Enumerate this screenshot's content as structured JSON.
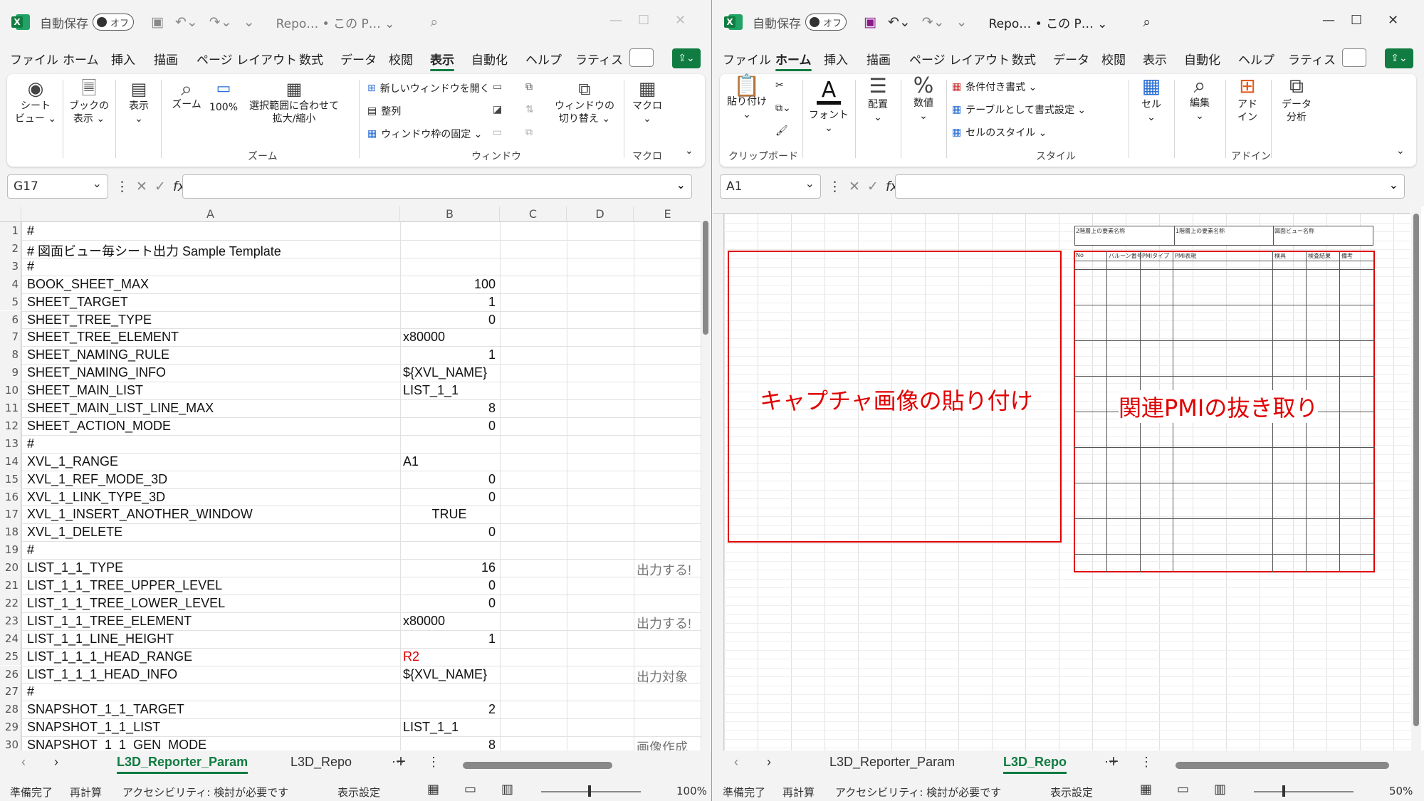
{
  "left": {
    "autosave_label": "自動保存",
    "autosave_state": "オフ",
    "doc_title": "Repo… • この P… ⌄",
    "menu": [
      "ファイル",
      "ホーム",
      "挿入",
      "描画",
      "ページ レイアウト",
      "数式",
      "データ",
      "校閲",
      "表示",
      "自動化",
      "ヘルプ",
      "ラティス"
    ],
    "active_menu": "表示",
    "ribbon": {
      "sheet_view": "シート\nビュー ⌄",
      "book_view": "ブックの\n表示 ⌄",
      "show": "表示\n⌄",
      "zoom": "ズーム",
      "zoom100": "100%",
      "zoom_fit": "選択範囲に合わせて\n拡大/縮小",
      "zoom_group": "ズーム",
      "new_window": "新しいウィンドウを開く",
      "arrange": "整列",
      "freeze": "ウィンドウ枠の固定 ⌄",
      "switch_window": "ウィンドウの\n切り替え ⌄",
      "window_group": "ウィンドウ",
      "macro": "マクロ\n⌄",
      "macro_group": "マクロ"
    },
    "namebox": "G17",
    "fx": "fx",
    "columns": [
      "A",
      "B",
      "C",
      "D",
      "E"
    ],
    "rows": [
      {
        "n": "1",
        "a": "#",
        "b": "",
        "e": ""
      },
      {
        "n": "2",
        "a": "#  図面ビュー毎シート出力 Sample Template",
        "b": "",
        "e": ""
      },
      {
        "n": "3",
        "a": "#",
        "b": "",
        "e": ""
      },
      {
        "n": "4",
        "a": "BOOK_SHEET_MAX",
        "b": "100",
        "e": ""
      },
      {
        "n": "5",
        "a": "SHEET_TARGET",
        "b": "1",
        "e": ""
      },
      {
        "n": "6",
        "a": "SHEET_TREE_TYPE",
        "b": "0",
        "e": ""
      },
      {
        "n": "7",
        "a": "SHEET_TREE_ELEMENT",
        "b": "x80000",
        "e": ""
      },
      {
        "n": "8",
        "a": "SHEET_NAMING_RULE",
        "b": "1",
        "e": ""
      },
      {
        "n": "9",
        "a": "SHEET_NAMING_INFO",
        "b": "${XVL_NAME}",
        "e": ""
      },
      {
        "n": "10",
        "a": "SHEET_MAIN_LIST",
        "b": "LIST_1_1",
        "e": ""
      },
      {
        "n": "11",
        "a": "SHEET_MAIN_LIST_LINE_MAX",
        "b": "8",
        "e": ""
      },
      {
        "n": "12",
        "a": "SHEET_ACTION_MODE",
        "b": "0",
        "e": ""
      },
      {
        "n": "13",
        "a": "#",
        "b": "",
        "e": ""
      },
      {
        "n": "14",
        "a": "XVL_1_RANGE",
        "b": "A1",
        "e": ""
      },
      {
        "n": "15",
        "a": "XVL_1_REF_MODE_3D",
        "b": "0",
        "e": ""
      },
      {
        "n": "16",
        "a": "XVL_1_LINK_TYPE_3D",
        "b": "0",
        "e": ""
      },
      {
        "n": "17",
        "a": "XVL_1_INSERT_ANOTHER_WINDOW",
        "b": "TRUE",
        "e": ""
      },
      {
        "n": "18",
        "a": "XVL_1_DELETE",
        "b": "0",
        "e": ""
      },
      {
        "n": "19",
        "a": "#",
        "b": "",
        "e": ""
      },
      {
        "n": "20",
        "a": "LIST_1_1_TYPE",
        "b": "16",
        "e": "出力する!"
      },
      {
        "n": "21",
        "a": "LIST_1_1_TREE_UPPER_LEVEL",
        "b": "0",
        "e": ""
      },
      {
        "n": "22",
        "a": "LIST_1_1_TREE_LOWER_LEVEL",
        "b": "0",
        "e": ""
      },
      {
        "n": "23",
        "a": "LIST_1_1_TREE_ELEMENT",
        "b": "x80000",
        "e": "出力する!"
      },
      {
        "n": "24",
        "a": "LIST_1_1_LINE_HEIGHT",
        "b": "1",
        "e": ""
      },
      {
        "n": "25",
        "a": "LIST_1_1_1_HEAD_RANGE",
        "b": "R2",
        "e": ""
      },
      {
        "n": "26",
        "a": "LIST_1_1_1_HEAD_INFO",
        "b": "${XVL_NAME}",
        "e": "出力対象"
      },
      {
        "n": "27",
        "a": "#",
        "b": "",
        "e": ""
      },
      {
        "n": "28",
        "a": "SNAPSHOT_1_1_TARGET",
        "b": "2",
        "e": ""
      },
      {
        "n": "29",
        "a": "SNAPSHOT_1_1_LIST",
        "b": "LIST_1_1",
        "e": ""
      },
      {
        "n": "30",
        "a": "SNAPSHOT_1_1_GEN_MODE",
        "b": "8",
        "e": "画像作成"
      }
    ],
    "red_value_color": "#e00000",
    "tabs": [
      "L3D_Reporter_Param",
      "L3D_Repo"
    ],
    "active_tab": "L3D_Reporter_Param",
    "status": {
      "ready": "準備完了",
      "recalc": "再計算",
      "accessibility": "アクセシビリティ: 検討が必要です",
      "display": "表示設定",
      "zoom": "100%"
    }
  },
  "right": {
    "autosave_label": "自動保存",
    "autosave_state": "オフ",
    "doc_title": "Repo… • この P… ⌄",
    "menu": [
      "ファイル",
      "ホーム",
      "挿入",
      "描画",
      "ページ レイアウト",
      "数式",
      "データ",
      "校閲",
      "表示",
      "自動化",
      "ヘルプ",
      "ラティス"
    ],
    "active_menu": "ホーム",
    "ribbon": {
      "paste": "貼り付け\n⌄",
      "clipboard_group": "クリップボード",
      "font": "フォント\n⌄",
      "align": "配置\n⌄",
      "number": "数値\n⌄",
      "cond_format": "条件付き書式 ⌄",
      "table_format": "テーブルとして書式設定 ⌄",
      "cell_style": "セルのスタイル ⌄",
      "style_group": "スタイル",
      "cell": "セル\n⌄",
      "edit": "編集\n⌄",
      "addin": "アド\nイン",
      "addin_group": "アドイン",
      "data_analysis": "データ\n分析"
    },
    "namebox": "A1",
    "fx": "fx",
    "header_labels": [
      "2階層上の要素名称",
      "1階層上の要素名称",
      "図面ビュー名称"
    ],
    "table_headers": [
      "No",
      "バルーン番号",
      "PMIタイプ",
      "PMI表現",
      "検具",
      "検査結果",
      "備考"
    ],
    "capture_label": "キャプチャ画像の貼り付け",
    "pmi_label": "関連PMIの抜き取り",
    "accent_red": "#e00000",
    "tabs": [
      "L3D_Reporter_Param",
      "L3D_Repo"
    ],
    "active_tab": "L3D_Repo",
    "status": {
      "ready": "準備完了",
      "recalc": "再計算",
      "accessibility": "アクセシビリティ: 検討が必要です",
      "display": "表示設定",
      "zoom": "50%"
    }
  }
}
